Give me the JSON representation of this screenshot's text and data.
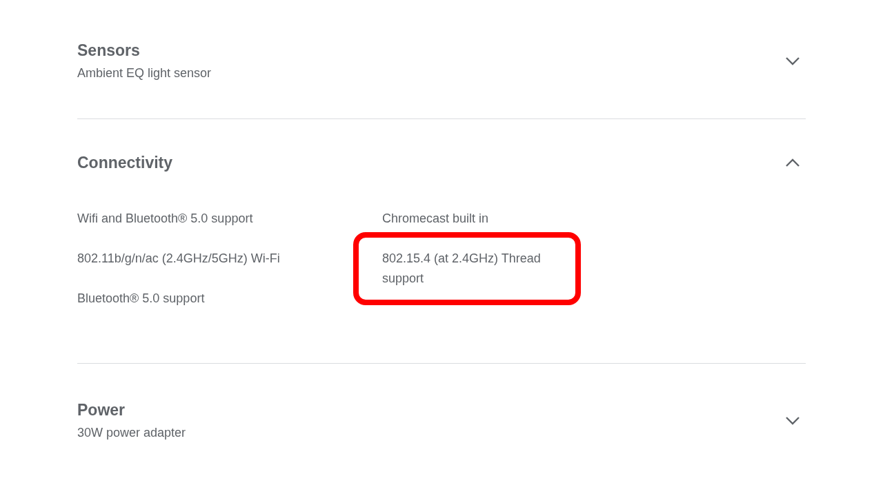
{
  "sections": [
    {
      "title": "Sensors",
      "subtitle": "Ambient EQ light sensor",
      "expanded": false
    },
    {
      "title": "Connectivity",
      "expanded": true,
      "columns": [
        [
          {
            "text": "Wifi and Bluetooth® 5.0 support",
            "highlighted": false
          },
          {
            "text": "802.11b/g/n/ac (2.4GHz/5GHz) Wi-Fi",
            "highlighted": false
          },
          {
            "text": "Bluetooth® 5.0 support",
            "highlighted": false
          }
        ],
        [
          {
            "text": "Chromecast built in",
            "highlighted": false
          },
          {
            "text": "802.15.4 (at 2.4GHz) Thread support",
            "highlighted": true
          }
        ]
      ]
    },
    {
      "title": "Power",
      "subtitle": "30W power adapter",
      "expanded": false
    }
  ]
}
